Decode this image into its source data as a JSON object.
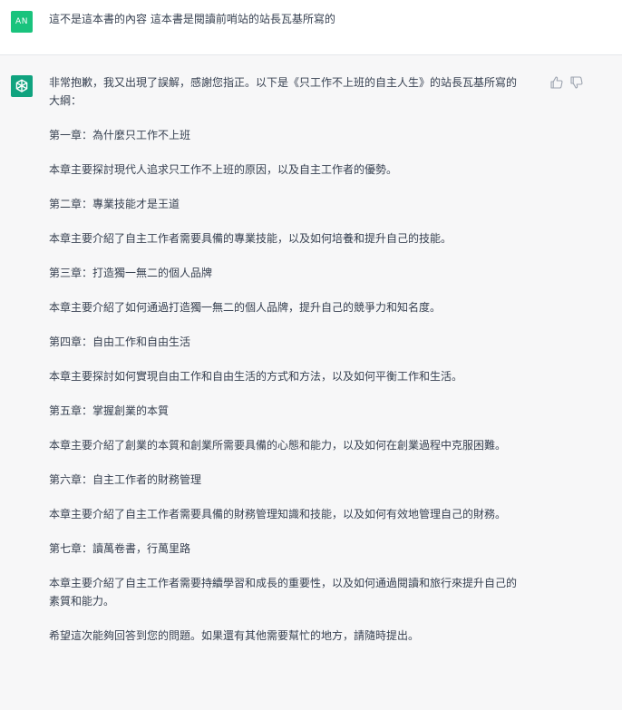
{
  "user": {
    "avatar_initials": "AN",
    "avatar_color": "#19c37d",
    "message": "這不是這本書的內容 這本書是閱讀前哨站的站長瓦基所寫的"
  },
  "assistant": {
    "avatar_icon": "openai-logo-icon",
    "avatar_color": "#10a37f",
    "paragraphs": [
      "非常抱歉，我又出現了誤解，感謝您指正。以下是《只工作不上班的自主人生》的站長瓦基所寫的大綱：",
      "第一章：為什麼只工作不上班",
      "本章主要探討現代人追求只工作不上班的原因，以及自主工作者的優勢。",
      "第二章：專業技能才是王道",
      "本章主要介紹了自主工作者需要具備的專業技能，以及如何培養和提升自己的技能。",
      "第三章：打造獨一無二的個人品牌",
      "本章主要介紹了如何通過打造獨一無二的個人品牌，提升自己的競爭力和知名度。",
      "第四章：自由工作和自由生活",
      "本章主要探討如何實現自由工作和自由生活的方式和方法，以及如何平衡工作和生活。",
      "第五章：掌握創業的本質",
      "本章主要介紹了創業的本質和創業所需要具備的心態和能力，以及如何在創業過程中克服困難。",
      "第六章：自主工作者的財務管理",
      "本章主要介紹了自主工作者需要具備的財務管理知識和技能，以及如何有效地管理自己的財務。",
      "第七章：讀萬卷書，行萬里路",
      "本章主要介紹了自主工作者需要持續學習和成長的重要性，以及如何通過閱讀和旅行來提升自己的素質和能力。",
      "希望這次能夠回答到您的問題。如果還有其他需要幫忙的地方，請隨時提出。"
    ]
  },
  "feedback": {
    "thumbs_up_icon": "thumbs-up-icon",
    "thumbs_down_icon": "thumbs-down-icon"
  }
}
